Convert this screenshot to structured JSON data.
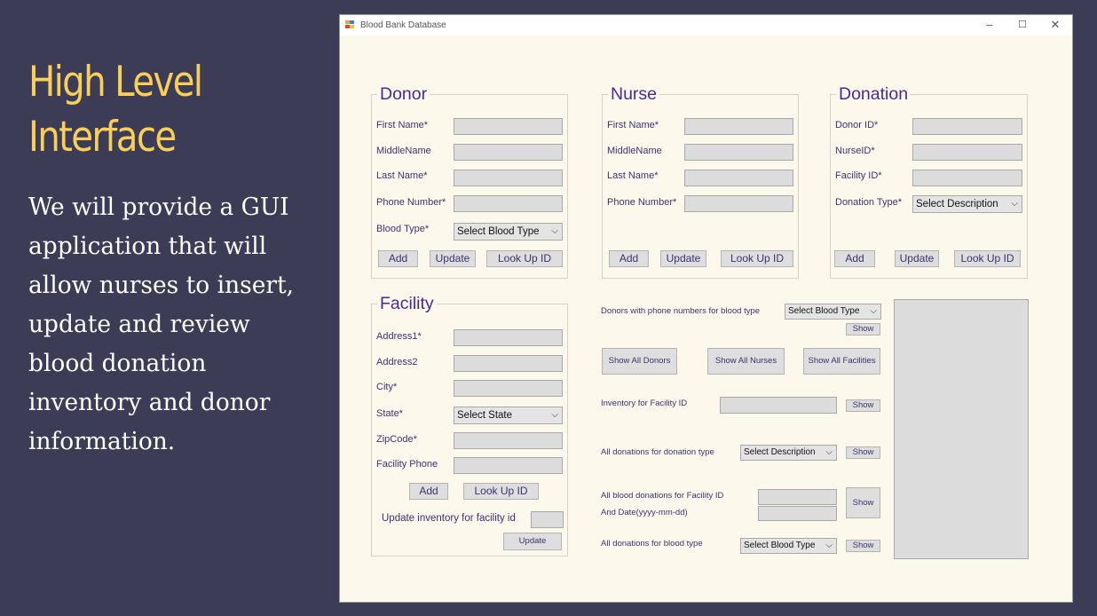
{
  "slide": {
    "title": "High Level Interface",
    "body": "We will provide a GUI application that will allow nurses to insert, update and review blood donation inventory and donor information."
  },
  "window": {
    "title": "Blood Bank Database",
    "controls": {
      "minimize": "–",
      "maximize": "☐",
      "close": "✕"
    }
  },
  "donor": {
    "title": "Donor",
    "first_name": "First Name*",
    "middle_name": "MiddleName",
    "last_name": "Last Name*",
    "phone": "Phone Number*",
    "blood_type": "Blood Type*",
    "blood_type_select": "Select Blood Type",
    "add": "Add",
    "update": "Update",
    "lookup": "Look Up ID"
  },
  "nurse": {
    "title": "Nurse",
    "first_name": "First Name*",
    "middle_name": "MiddleName",
    "last_name": "Last Name*",
    "phone": "Phone Number*",
    "add": "Add",
    "update": "Update",
    "lookup": "Look Up ID"
  },
  "donation": {
    "title": "Donation",
    "donor_id": "Donor ID*",
    "nurse_id": "NurseID*",
    "facility_id": "Facility ID*",
    "donation_type": "Donation Type*",
    "donation_type_select": "Select Description",
    "add": "Add",
    "update": "Update",
    "lookup": "Look Up ID"
  },
  "facility": {
    "title": "Facility",
    "address1": "Address1*",
    "address2": "Address2",
    "city": "City*",
    "state": "State*",
    "state_select": "Select State",
    "zipcode": "ZipCode*",
    "phone": "Facility Phone",
    "add": "Add",
    "lookup": "Look Up ID",
    "update_inventory_label": "Update inventory for facility id",
    "update": "Update"
  },
  "queries": {
    "donors_by_blood_type": "Donors with phone numbers for blood type",
    "blood_type_select": "Select Blood Type",
    "show": "Show",
    "show_all_donors": "Show All Donors",
    "show_all_nurses": "Show All Nurses",
    "show_all_facilities": "Show All Facilities",
    "inventory_for_facility": "Inventory for Facility ID",
    "donations_by_type": "All donations for donation type",
    "description_select": "Select Description",
    "donations_facility_date_1": "All blood donations for Facility ID",
    "donations_facility_date_2": "And Date(yyyy-mm-dd)",
    "donations_by_blood_type": "All donations for blood type"
  }
}
